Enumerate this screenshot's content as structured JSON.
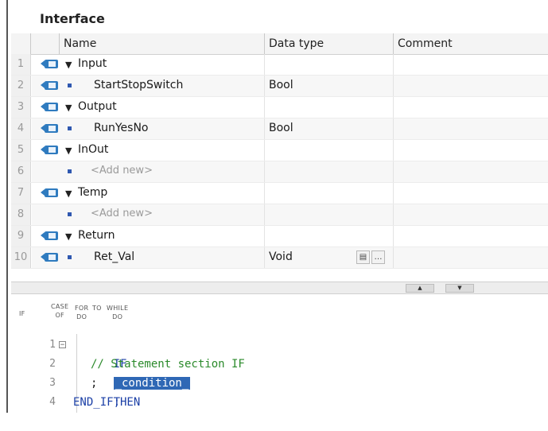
{
  "interface": {
    "title": "Interface",
    "columns": {
      "name": "Name",
      "data_type": "Data type",
      "comment": "Comment"
    },
    "rows": [
      {
        "num": "1",
        "name": "Input",
        "data_type": "",
        "kind": "section"
      },
      {
        "num": "2",
        "name": "StartStopSwitch",
        "data_type": "Bool",
        "kind": "variable"
      },
      {
        "num": "3",
        "name": "Output",
        "data_type": "",
        "kind": "section"
      },
      {
        "num": "4",
        "name": "RunYesNo",
        "data_type": "Bool",
        "kind": "variable"
      },
      {
        "num": "5",
        "name": "InOut",
        "data_type": "",
        "kind": "section"
      },
      {
        "num": "6",
        "name": "<Add new>",
        "data_type": "",
        "kind": "add"
      },
      {
        "num": "7",
        "name": "Temp",
        "data_type": "",
        "kind": "section"
      },
      {
        "num": "8",
        "name": "<Add new>",
        "data_type": "",
        "kind": "add"
      },
      {
        "num": "9",
        "name": "Return",
        "data_type": "",
        "kind": "section"
      },
      {
        "num": "10",
        "name": "Ret_Val",
        "data_type": "Void",
        "kind": "variable"
      }
    ],
    "row10_buttons": {
      "list": "▤",
      "more": "…"
    }
  },
  "splitter": {
    "up": "▲",
    "down": "▼"
  },
  "toolbar": {
    "if": "IF",
    "case_top": "CASE",
    "case_bottom": "OF",
    "for_top": "FOR",
    "for_bottom": "DO",
    "to_top": "TO",
    "while_top": "WHILE",
    "while_bottom": "DO"
  },
  "code": {
    "lines": [
      {
        "num": "1",
        "kw1": "IF",
        "cond": "_condition_",
        "kw2": "THEN"
      },
      {
        "num": "2",
        "comment": "// Statement section IF"
      },
      {
        "num": "3",
        "text": ";"
      },
      {
        "num": "4",
        "kw": "END_IF;"
      }
    ],
    "fold_symbol": "−"
  }
}
